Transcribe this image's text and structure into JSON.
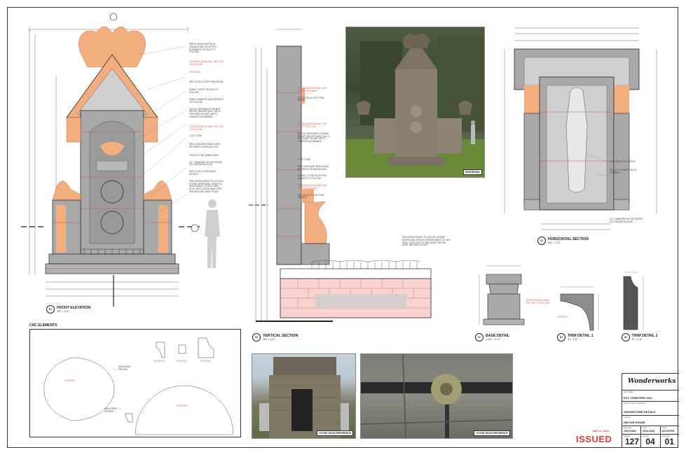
{
  "views": {
    "v1": {
      "badge": "E1",
      "title": "FRONT ELEVATION",
      "scale": "3/4\" = 1'-0\""
    },
    "v2": {
      "badge": "S2",
      "title": "VERTICAL SECTION",
      "scale": "3/4\" = 1'-0\""
    },
    "v3": {
      "badge": "S1",
      "title": "HORIZONTAL SECTION",
      "scale": "3/4\" = 1'-0\""
    },
    "v4": {
      "badge": "D1",
      "title": "BASE DETAIL",
      "scale": "1-1/2\" = 1'-0\""
    },
    "v5": {
      "badge": "D2",
      "title": "TRIM DETAIL 1",
      "scale": "3\" = 1'-0\""
    },
    "v6": {
      "badge": "D3",
      "title": "TRIM DETAIL 2",
      "scale": "3\" = 1'-0\""
    }
  },
  "cnc": {
    "title": "CNC ELEMENTS",
    "codes": [
      "12TGR101",
      "12TGR102",
      "12TGR103",
      "12TGR104",
      "12TGR105"
    ],
    "notes": [
      "MOULDING PROFILE",
      "MOULDING PROFILE"
    ]
  },
  "elevation_notes": [
    "PARTS HIGHLIGHTED IN ORANGE ARE SCULPTED ELEMENTS. DETAILS TO FOLLOW",
    "12TGR101 MOULDING CNC FILE TO FOLLOW",
    "12TGR106",
    "SEE D2 SK-01 FOR TRIM DETAIL",
    "FAMILY CREST DETAILS TO FOLLOW",
    "FAMILY NAME PLAQUE DETAILS TO FOLLOW",
    "CIRCLE OPENINGS FOR BAS RELIEF (RELIEFS ARE CNC & PROVIDED BY ART DEPT.) FINISHED AS MARBLE",
    "12TGR102 MOULDING CNC FILE TO FOLLOW",
    "1-1/2\" COVE",
    "RED LINES ARE SEAM LINES BETWEEN STONE BLOCKS",
    "FENCE TO BE FABRICATED",
    "1/2\" CHAMFER ON TOP EDGES OF CORNER BLOCKS",
    "SEE D1 SK-01 FOR BASE DETAILS",
    "PINS FROM FENCE TO GO INTO STONE SURROUND. FENCE IS REMOVABLE. DO NOT DRILL HOLE INTO STONE BASE FOR PIN UNTIL WE HAVE FENCE"
  ],
  "section_notes": [
    "12TGR103 MOULDING CNC FILE TO FOLLOW",
    "SEE D2 SK-01 FOR TRIM DETAIL",
    "12TGR104 MOULDING CNC FILE TO FOLLOW",
    "CIRCLE OPENINGS FOR BAS RELIEF (RELIEFS ARE CNC & PROVIDED BY ART DEPT.) FINISHED AS MARBLE",
    "1-1/2\" COVE",
    "RED LINES ARE SEAM LINES BETWEEN STONE BLOCKS",
    "SCROLL TO BE SCULPTED. DETAILS TO FOLLOW",
    "12TGR105 MOULDING CNC FILE TO FOLLOW",
    "SEE D1 SK-01 FOR TRIM DETAILS",
    "PINS FROM FENCE TO GO INTO STONE SURROUND. FENCE IS REMOVABLE. DO NOT DRILL HOLE INTO STONE BASE FOR PIN UNTIL WE HAVE FENCE"
  ],
  "plan_notes": [
    "FOOTPRINT OF COFFIN",
    "SOIL AT THE BOTTOM OF OPENING",
    "1/2\" CHAMFER ON TOP EDGES OF CORNER BLOCKS"
  ],
  "detail_codes": {
    "base": "12TGR106 MOULDING CNC FILE TO FOLLOW",
    "trim": "12TGR101"
  },
  "photos": {
    "rendering": "RENDERING",
    "ref1": "STONE SEAM REFERENCE",
    "ref2": "STONE SEAM REFERENCE"
  },
  "title_block": {
    "logo": "Wonderworks",
    "project_cap": "SET NAME",
    "project": "EXT. CEMETERY HILL",
    "sheet_cap": "Drawing Name / Description",
    "sheet": "GRAVESTONE DETAILS",
    "client_cap": "Location",
    "client": "WILTON HOUSE",
    "drawn_cap": "Drawn By",
    "drawn": "JON CHAN",
    "date_cap": "Date",
    "date": "09.01.2024",
    "scale_cap": "Scale",
    "scale": "AS NOTED",
    "ep_cap": "Episode",
    "ep": "127",
    "set_cap": "Set No.",
    "set": "04",
    "sheet_no_cap": "Sheet No.",
    "sheet_no": "01"
  },
  "stamp": {
    "status": "ISSUED",
    "date": "MAY 21, 2024"
  },
  "colors": {
    "stone": "#a9a9a9",
    "sculpt": "#f3ae80",
    "seam": "#d9534f",
    "brick": "#f7d4d0"
  }
}
